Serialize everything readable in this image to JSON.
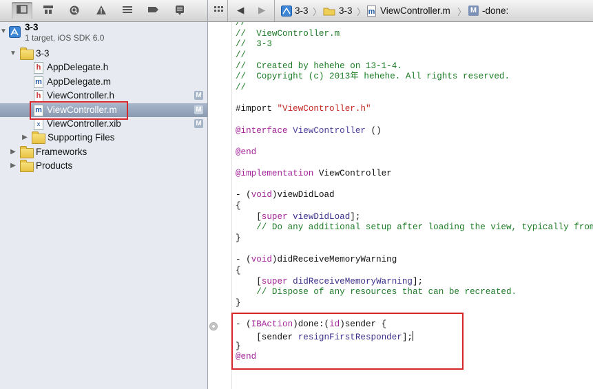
{
  "navigator": {
    "toolbar_icons": [
      "project-navigator-icon",
      "symbol-navigator-icon",
      "search-navigator-icon",
      "issue-navigator-icon",
      "debug-navigator-icon",
      "breakpoint-navigator-icon",
      "log-navigator-icon"
    ],
    "project": {
      "name": "3-3",
      "subtitle": "1 target, iOS SDK 6.0"
    },
    "items": [
      {
        "label": "3-3",
        "kind": "folder",
        "depth": 1,
        "expanded": true,
        "badge": ""
      },
      {
        "label": "AppDelegate.h",
        "kind": "h",
        "depth": 2,
        "badge": ""
      },
      {
        "label": "AppDelegate.m",
        "kind": "m",
        "depth": 2,
        "badge": ""
      },
      {
        "label": "ViewController.h",
        "kind": "h",
        "depth": 2,
        "badge": "M"
      },
      {
        "label": "ViewController.m",
        "kind": "m",
        "depth": 2,
        "badge": "M",
        "selected": true
      },
      {
        "label": "ViewController.xib",
        "kind": "xib",
        "depth": 2,
        "badge": "M"
      },
      {
        "label": "Supporting Files",
        "kind": "folder",
        "depth": 2,
        "expanded": false,
        "badge": ""
      },
      {
        "label": "Frameworks",
        "kind": "folder",
        "depth": 1,
        "expanded": false,
        "badge": ""
      },
      {
        "label": "Products",
        "kind": "folder",
        "depth": 1,
        "expanded": false,
        "badge": ""
      }
    ],
    "file_icon_letters": {
      "h": "h",
      "m": "m",
      "xib": "x"
    }
  },
  "jumpbar": {
    "crumbs": [
      "3-3",
      "3-3",
      "ViewController.m",
      "-done:"
    ],
    "method_badge": "M"
  },
  "colors": {
    "highlight": "#d5262b",
    "comment": "#1b7c25",
    "keyword": "#a5249a",
    "string": "#c4251f"
  },
  "code": {
    "lines": [
      [
        [
          "cm",
          "//"
        ]
      ],
      [
        [
          "cm",
          "//  ViewController.m"
        ]
      ],
      [
        [
          "cm",
          "//  3-3"
        ]
      ],
      [
        [
          "cm",
          "//"
        ]
      ],
      [
        [
          "cm",
          "//  Created by hehehe on 13-1-4."
        ]
      ],
      [
        [
          "cm",
          "//  Copyright (c) 2013年 hehehe. All rights reserved."
        ]
      ],
      [
        [
          "cm",
          "//"
        ]
      ],
      [],
      [
        [
          "",
          "#import "
        ],
        [
          "st",
          "\"ViewController.h\""
        ]
      ],
      [],
      [
        [
          "kw",
          "@interface"
        ],
        [
          "ty",
          " ViewController"
        ],
        [
          "",
          " ()"
        ]
      ],
      [],
      [
        [
          "kw",
          "@end"
        ]
      ],
      [],
      [
        [
          "kw",
          "@implementation"
        ],
        [
          "",
          " ViewController"
        ]
      ],
      [],
      [
        [
          "",
          "- ("
        ],
        [
          "kw",
          "void"
        ],
        [
          "",
          ")viewDidLoad"
        ]
      ],
      [
        [
          "",
          "{"
        ]
      ],
      [
        [
          "",
          "    ["
        ],
        [
          "kw",
          "super"
        ],
        [
          "mt",
          " viewDidLoad"
        ],
        [
          "",
          "];"
        ]
      ],
      [
        [
          "cm",
          "    // Do any additional setup after loading the view, typically from a nib."
        ]
      ],
      [
        [
          "",
          "}"
        ]
      ],
      [],
      [
        [
          "",
          "- ("
        ],
        [
          "kw",
          "void"
        ],
        [
          "",
          ")didReceiveMemoryWarning"
        ]
      ],
      [
        [
          "",
          "{"
        ]
      ],
      [
        [
          "",
          "    ["
        ],
        [
          "kw",
          "super"
        ],
        [
          "mt",
          " didReceiveMemoryWarning"
        ],
        [
          "",
          "];"
        ]
      ],
      [
        [
          "cm",
          "    // Dispose of any resources that can be recreated."
        ]
      ],
      [
        [
          "",
          "}"
        ]
      ],
      [],
      [
        [
          "",
          "- ("
        ],
        [
          "kw",
          "IBAction"
        ],
        [
          "",
          ")done:("
        ],
        [
          "kw",
          "id"
        ],
        [
          "",
          ")sender {"
        ]
      ],
      [
        [
          "",
          "    [sender "
        ],
        [
          "mt",
          "resignFirstResponder"
        ],
        [
          "",
          "];"
        ]
      ],
      [
        [
          "",
          "}"
        ]
      ],
      [
        [
          "kw",
          "@end"
        ]
      ]
    ]
  }
}
